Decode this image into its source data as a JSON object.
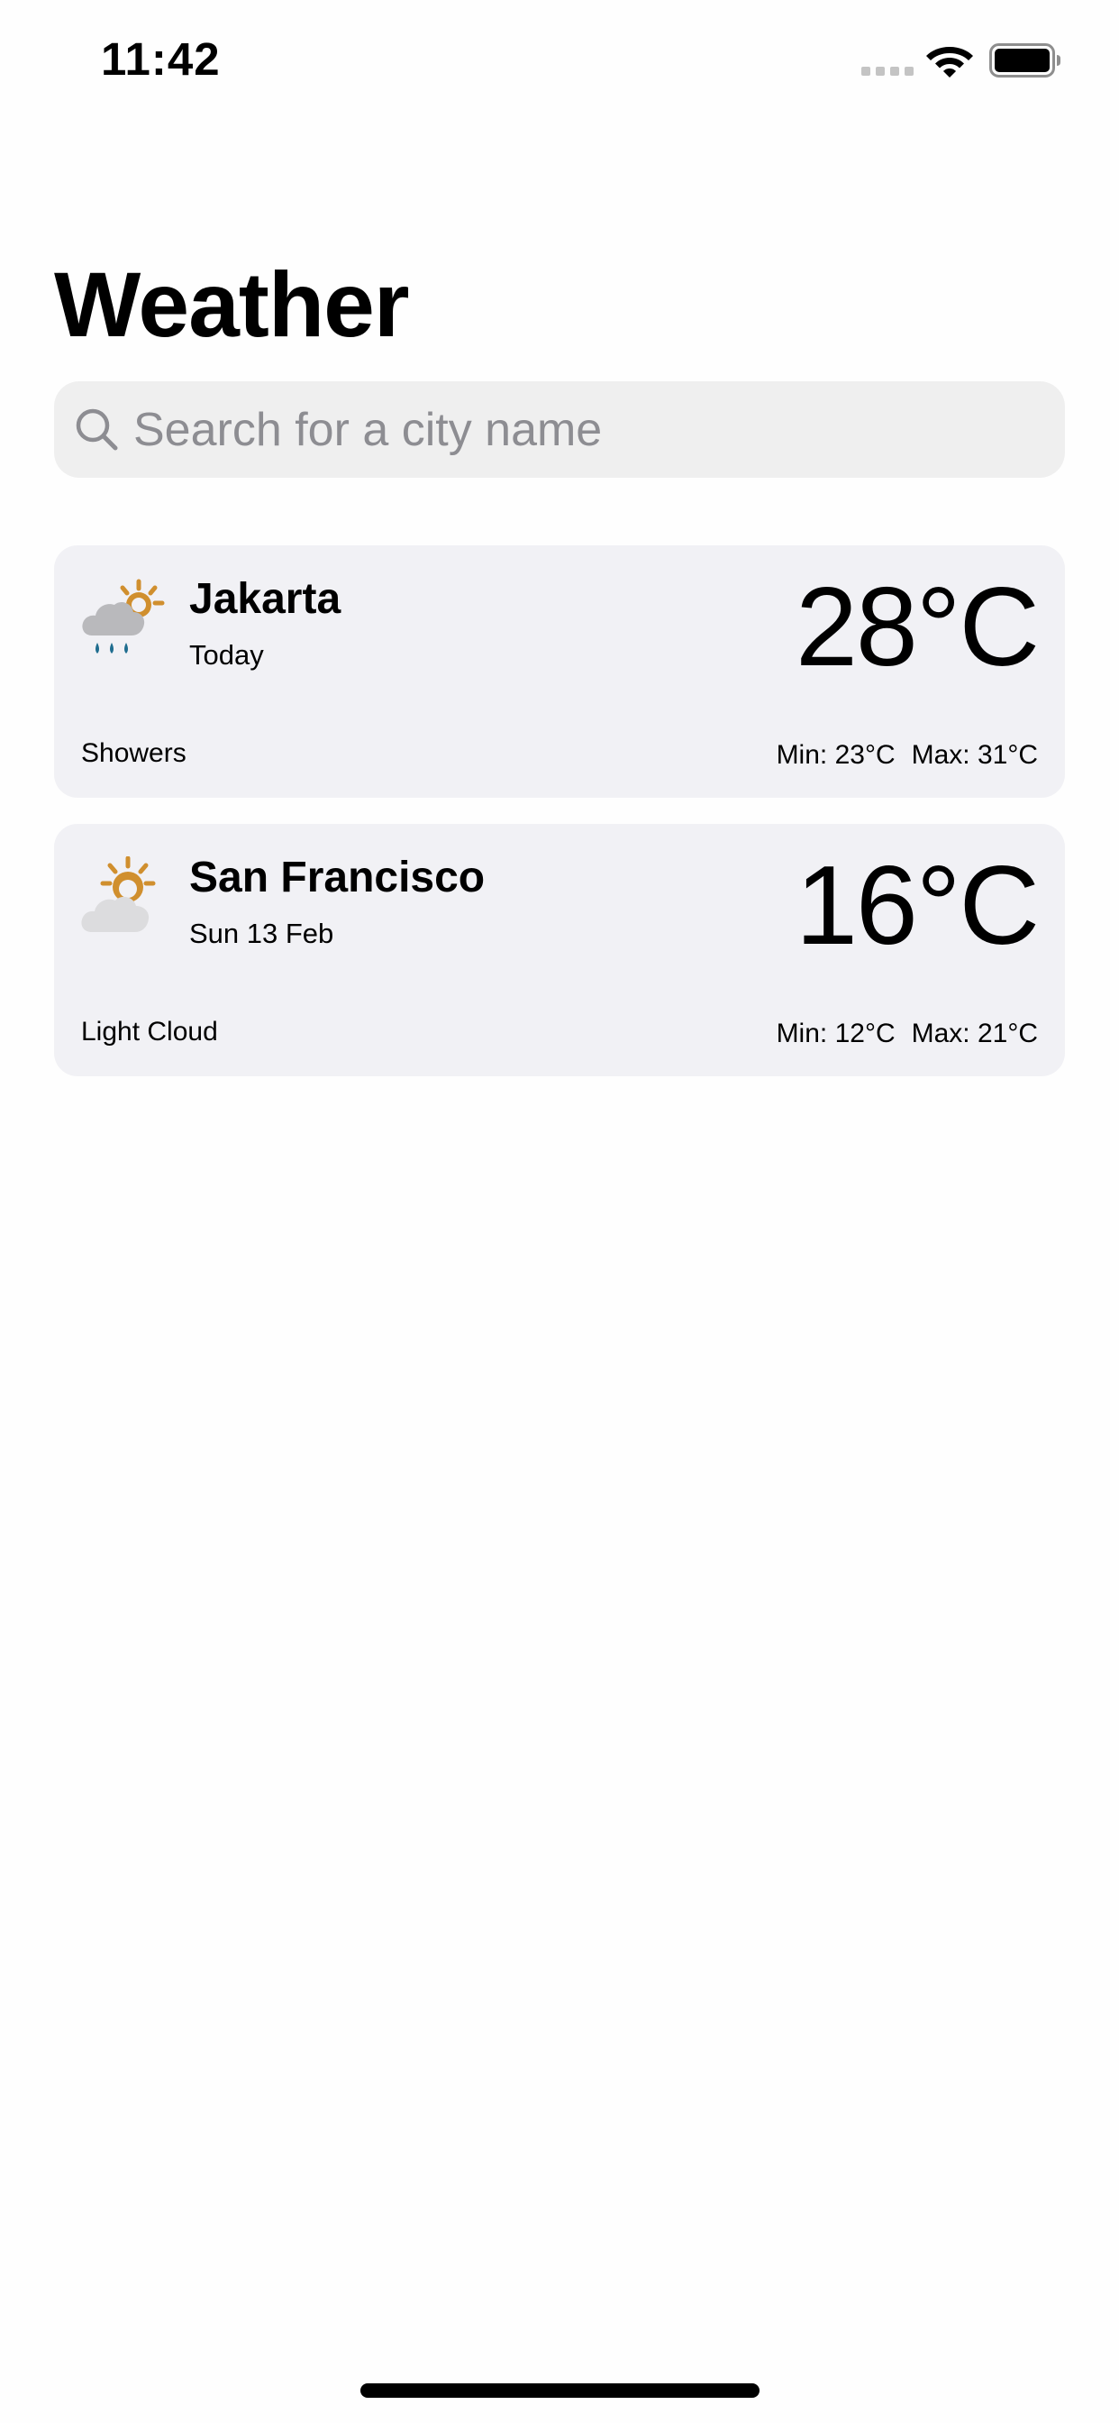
{
  "status_bar": {
    "time": "11:42"
  },
  "page": {
    "title": "Weather"
  },
  "search": {
    "placeholder": "Search for a city name",
    "value": ""
  },
  "cities": [
    {
      "name": "Jakarta",
      "date": "Today",
      "temperature": "28°C",
      "condition": "Showers",
      "min": "Min: 23°C",
      "max": "Max: 31°C",
      "icon": "sun-rain-cloud-icon"
    },
    {
      "name": "San Francisco",
      "date": "Sun 13 Feb",
      "temperature": "16°C",
      "condition": "Light Cloud",
      "min": "Min: 12°C",
      "max": "Max: 21°C",
      "icon": "sun-behind-cloud-icon"
    }
  ],
  "colors": {
    "card_background": "#f1f1f5",
    "search_background": "#efefef",
    "placeholder": "#8d8d92",
    "sun": "#d08f2e",
    "cloud_dark": "#b9b9bc",
    "cloud_light": "#dcdcde",
    "rain": "#1f6d8f"
  }
}
